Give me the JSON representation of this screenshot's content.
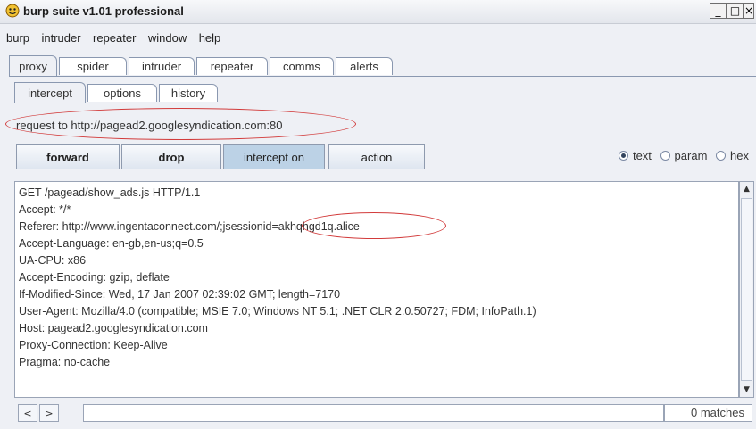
{
  "window": {
    "title": "burp suite v1.01 professional",
    "controls": {
      "minimize": "_",
      "maximize": "□",
      "close": "×"
    }
  },
  "menubar": {
    "items": [
      "burp",
      "intruder",
      "repeater",
      "window",
      "help"
    ]
  },
  "main_tabs": [
    "proxy",
    "spider",
    "intruder",
    "repeater",
    "comms",
    "alerts"
  ],
  "main_tabs_active": "proxy",
  "sub_tabs": [
    "intercept",
    "options",
    "history"
  ],
  "sub_tabs_active": "intercept",
  "request_label": "request to http://pagead2.googlesyndication.com:80",
  "buttons": {
    "forward": "forward",
    "drop": "drop",
    "intercept": "intercept on",
    "action": "action"
  },
  "view_mode": {
    "options": [
      "text",
      "param",
      "hex"
    ],
    "selected": "text"
  },
  "request_lines": [
    "GET /pagead/show_ads.js HTTP/1.1",
    "Accept: */*",
    "Referer: http://www.ingentaconnect.com/;jsessionid=akhqhgd1q.alice",
    "Accept-Language: en-gb,en-us;q=0.5",
    "UA-CPU: x86",
    "Accept-Encoding: gzip, deflate",
    "If-Modified-Since: Wed, 17 Jan 2007 02:39:02 GMT; length=7170",
    "User-Agent: Mozilla/4.0 (compatible; MSIE 7.0; Windows NT 5.1; .NET CLR 2.0.50727; FDM; InfoPath.1)",
    "Host: pagead2.googlesyndication.com",
    "Proxy-Connection: Keep-Alive",
    "Pragma: no-cache"
  ],
  "search": {
    "prev": "<",
    "next": ">",
    "value": "",
    "matches": "0 matches"
  },
  "colors": {
    "annotation": "#d23b3b",
    "toggled_button": "#bcd2e6"
  }
}
